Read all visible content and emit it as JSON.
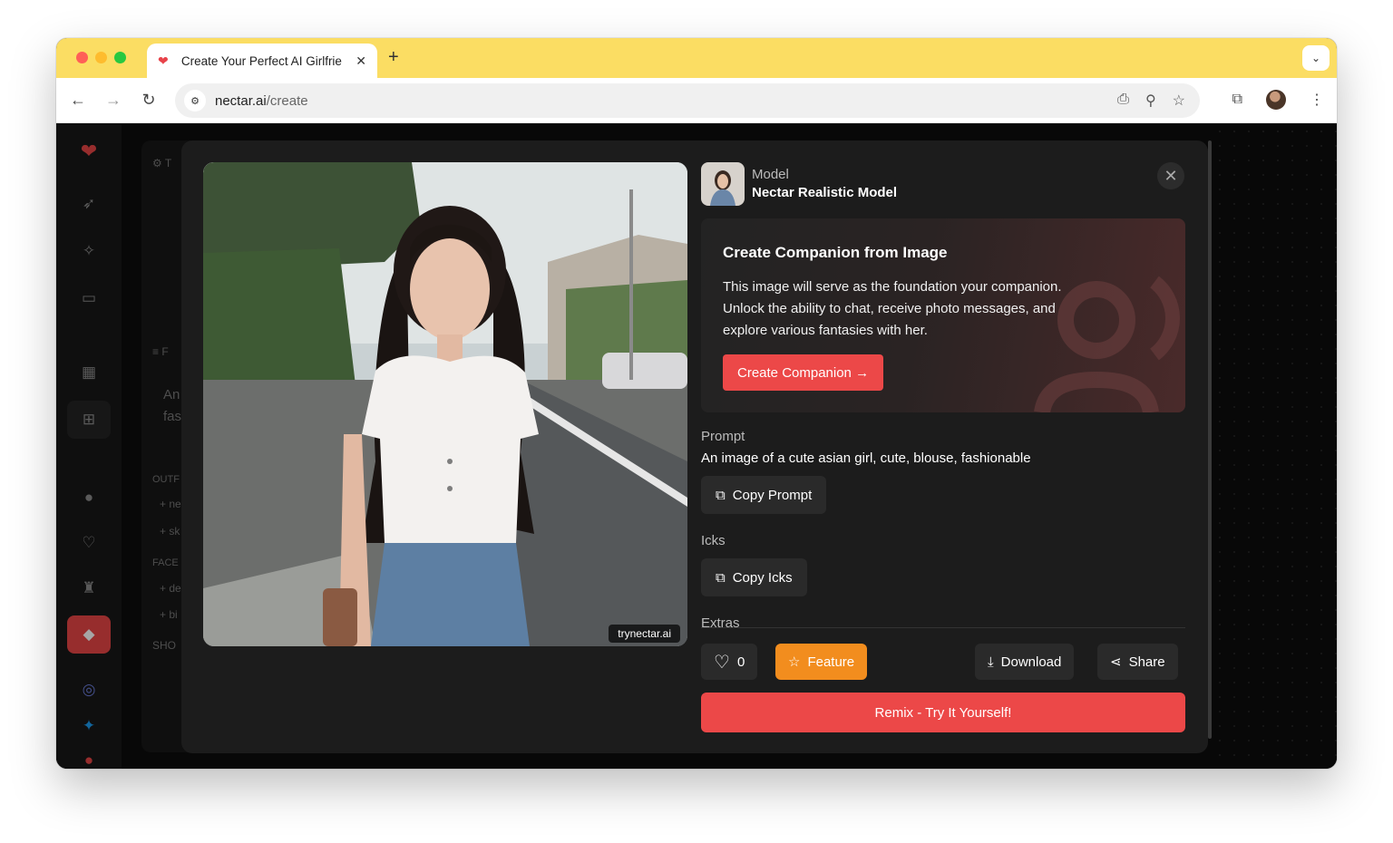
{
  "browser": {
    "tab_title": "Create Your Perfect AI Girlfrie",
    "url_host": "nectar.ai",
    "url_path": "/create"
  },
  "background": {
    "items": [
      "T",
      "F",
      "An",
      "fas",
      "OUTF",
      "+ ne",
      "+ sk",
      "FACE",
      "+ de",
      "+ bi",
      "SHO"
    ]
  },
  "modal": {
    "model_label": "Model",
    "model_name": "Nectar Realistic Model",
    "watermark": "trynectar.ai",
    "companion": {
      "title": "Create Companion from Image",
      "description": "This image will serve as the foundation your companion. Unlock the ability to chat, receive photo messages, and explore various fantasies with her.",
      "button": "Create Companion →"
    },
    "prompt_label": "Prompt",
    "prompt_text": "An image of a cute asian girl, cute, blouse, fashionable",
    "copy_prompt": "Copy Prompt",
    "icks_label": "Icks",
    "copy_icks": "Copy Icks",
    "extras_label": "Extras",
    "like_count": "0",
    "feature": "Feature",
    "download": "Download",
    "share": "Share",
    "remix": "Remix - Try It Yourself!"
  },
  "colors": {
    "accent": "#ec4848",
    "feature": "#f28d1e",
    "tabstrip": "#fbdd63"
  }
}
